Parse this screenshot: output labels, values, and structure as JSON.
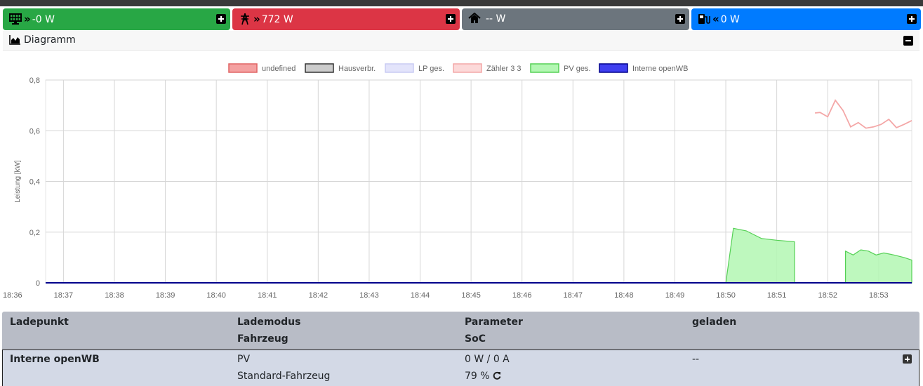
{
  "tiles": [
    {
      "label": "-0 W",
      "color": "#28a745",
      "icon": "solar-panel-icon",
      "arrow": "»"
    },
    {
      "label": "772 W",
      "color": "#dc3545",
      "icon": "power-pylon-icon",
      "arrow": "»"
    },
    {
      "label": "-- W",
      "color": "#6c757d",
      "icon": "home-icon",
      "arrow": ""
    },
    {
      "label": "0 W",
      "color": "#007bff",
      "icon": "charging-station-icon",
      "arrow": "«"
    }
  ],
  "diagram": {
    "title": "Diagramm",
    "icon": "chart-area-icon"
  },
  "chart_data": {
    "type": "area",
    "ylabel": "Leistung [kW]",
    "ylim": [
      0,
      0.8
    ],
    "yticks": [
      "0",
      "0,2",
      "0,4",
      "0,6",
      "0,8"
    ],
    "xticks": [
      "18:36",
      "18:37",
      "18:38",
      "18:39",
      "18:40",
      "18:41",
      "18:42",
      "18:43",
      "18:44",
      "18:45",
      "18:46",
      "18:47",
      "18:48",
      "18:49",
      "18:50",
      "18:51",
      "18:52",
      "18:53"
    ],
    "xrange": [
      36.65,
      53.65
    ],
    "legend_position": "top",
    "series": [
      {
        "name": "undefined",
        "fill": "#f4a1a1",
        "stroke": "#e06464",
        "points": []
      },
      {
        "name": "Hausverbr.",
        "fill": "#cccccc",
        "stroke": "#333333",
        "points": [
          [
            36.65,
            0
          ],
          [
            37.5,
            0
          ]
        ]
      },
      {
        "name": "LP ges.",
        "fill": "#e3e4fb",
        "stroke": "#c9cbf3",
        "points": []
      },
      {
        "name": "Zähler 3 3",
        "fill": "#fcd9d9",
        "stroke": "#f4a7a7",
        "points": [
          [
            51.75,
            0.67
          ],
          [
            51.85,
            0.672
          ],
          [
            52.0,
            0.655
          ],
          [
            52.15,
            0.72
          ],
          [
            52.3,
            0.68
          ],
          [
            52.45,
            0.615
          ],
          [
            52.6,
            0.632
          ],
          [
            52.75,
            0.61
          ],
          [
            52.9,
            0.615
          ],
          [
            53.05,
            0.625
          ],
          [
            53.2,
            0.645
          ],
          [
            53.35,
            0.612
          ],
          [
            53.5,
            0.625
          ],
          [
            53.65,
            0.64
          ]
        ]
      },
      {
        "name": "PV ges.",
        "fill": "#b3f7b3",
        "stroke": "#55d055",
        "segments": [
          [
            [
              50.0,
              0
            ],
            [
              50.15,
              0.215
            ],
            [
              50.4,
              0.205
            ],
            [
              50.7,
              0.175
            ],
            [
              51.0,
              0.168
            ],
            [
              51.35,
              0.162
            ],
            [
              51.35,
              0
            ]
          ],
          [
            [
              52.35,
              0
            ],
            [
              52.35,
              0.125
            ],
            [
              52.5,
              0.11
            ],
            [
              52.65,
              0.13
            ],
            [
              52.8,
              0.125
            ],
            [
              52.95,
              0.11
            ],
            [
              53.1,
              0.118
            ],
            [
              53.3,
              0.11
            ],
            [
              53.5,
              0.1
            ],
            [
              53.65,
              0.09
            ],
            [
              53.65,
              0
            ]
          ]
        ]
      },
      {
        "name": "Interne openWB",
        "fill": "#4040f0",
        "stroke": "#00008b",
        "points": [
          [
            36.65,
            0
          ],
          [
            53.65,
            0
          ]
        ]
      }
    ]
  },
  "table": {
    "headers": {
      "ladepunkt": "Ladepunkt",
      "lademodus": "Lademodus",
      "fahrzeug": "Fahrzeug",
      "parameter": "Parameter",
      "soc": "SoC",
      "geladen": "geladen"
    },
    "rows": [
      {
        "name": "Interne openWB",
        "mode": "PV",
        "vehicle": "Standard-Fahrzeug",
        "parameter": "0 W / 0 A",
        "soc": "79 %",
        "charged": "--"
      }
    ]
  }
}
